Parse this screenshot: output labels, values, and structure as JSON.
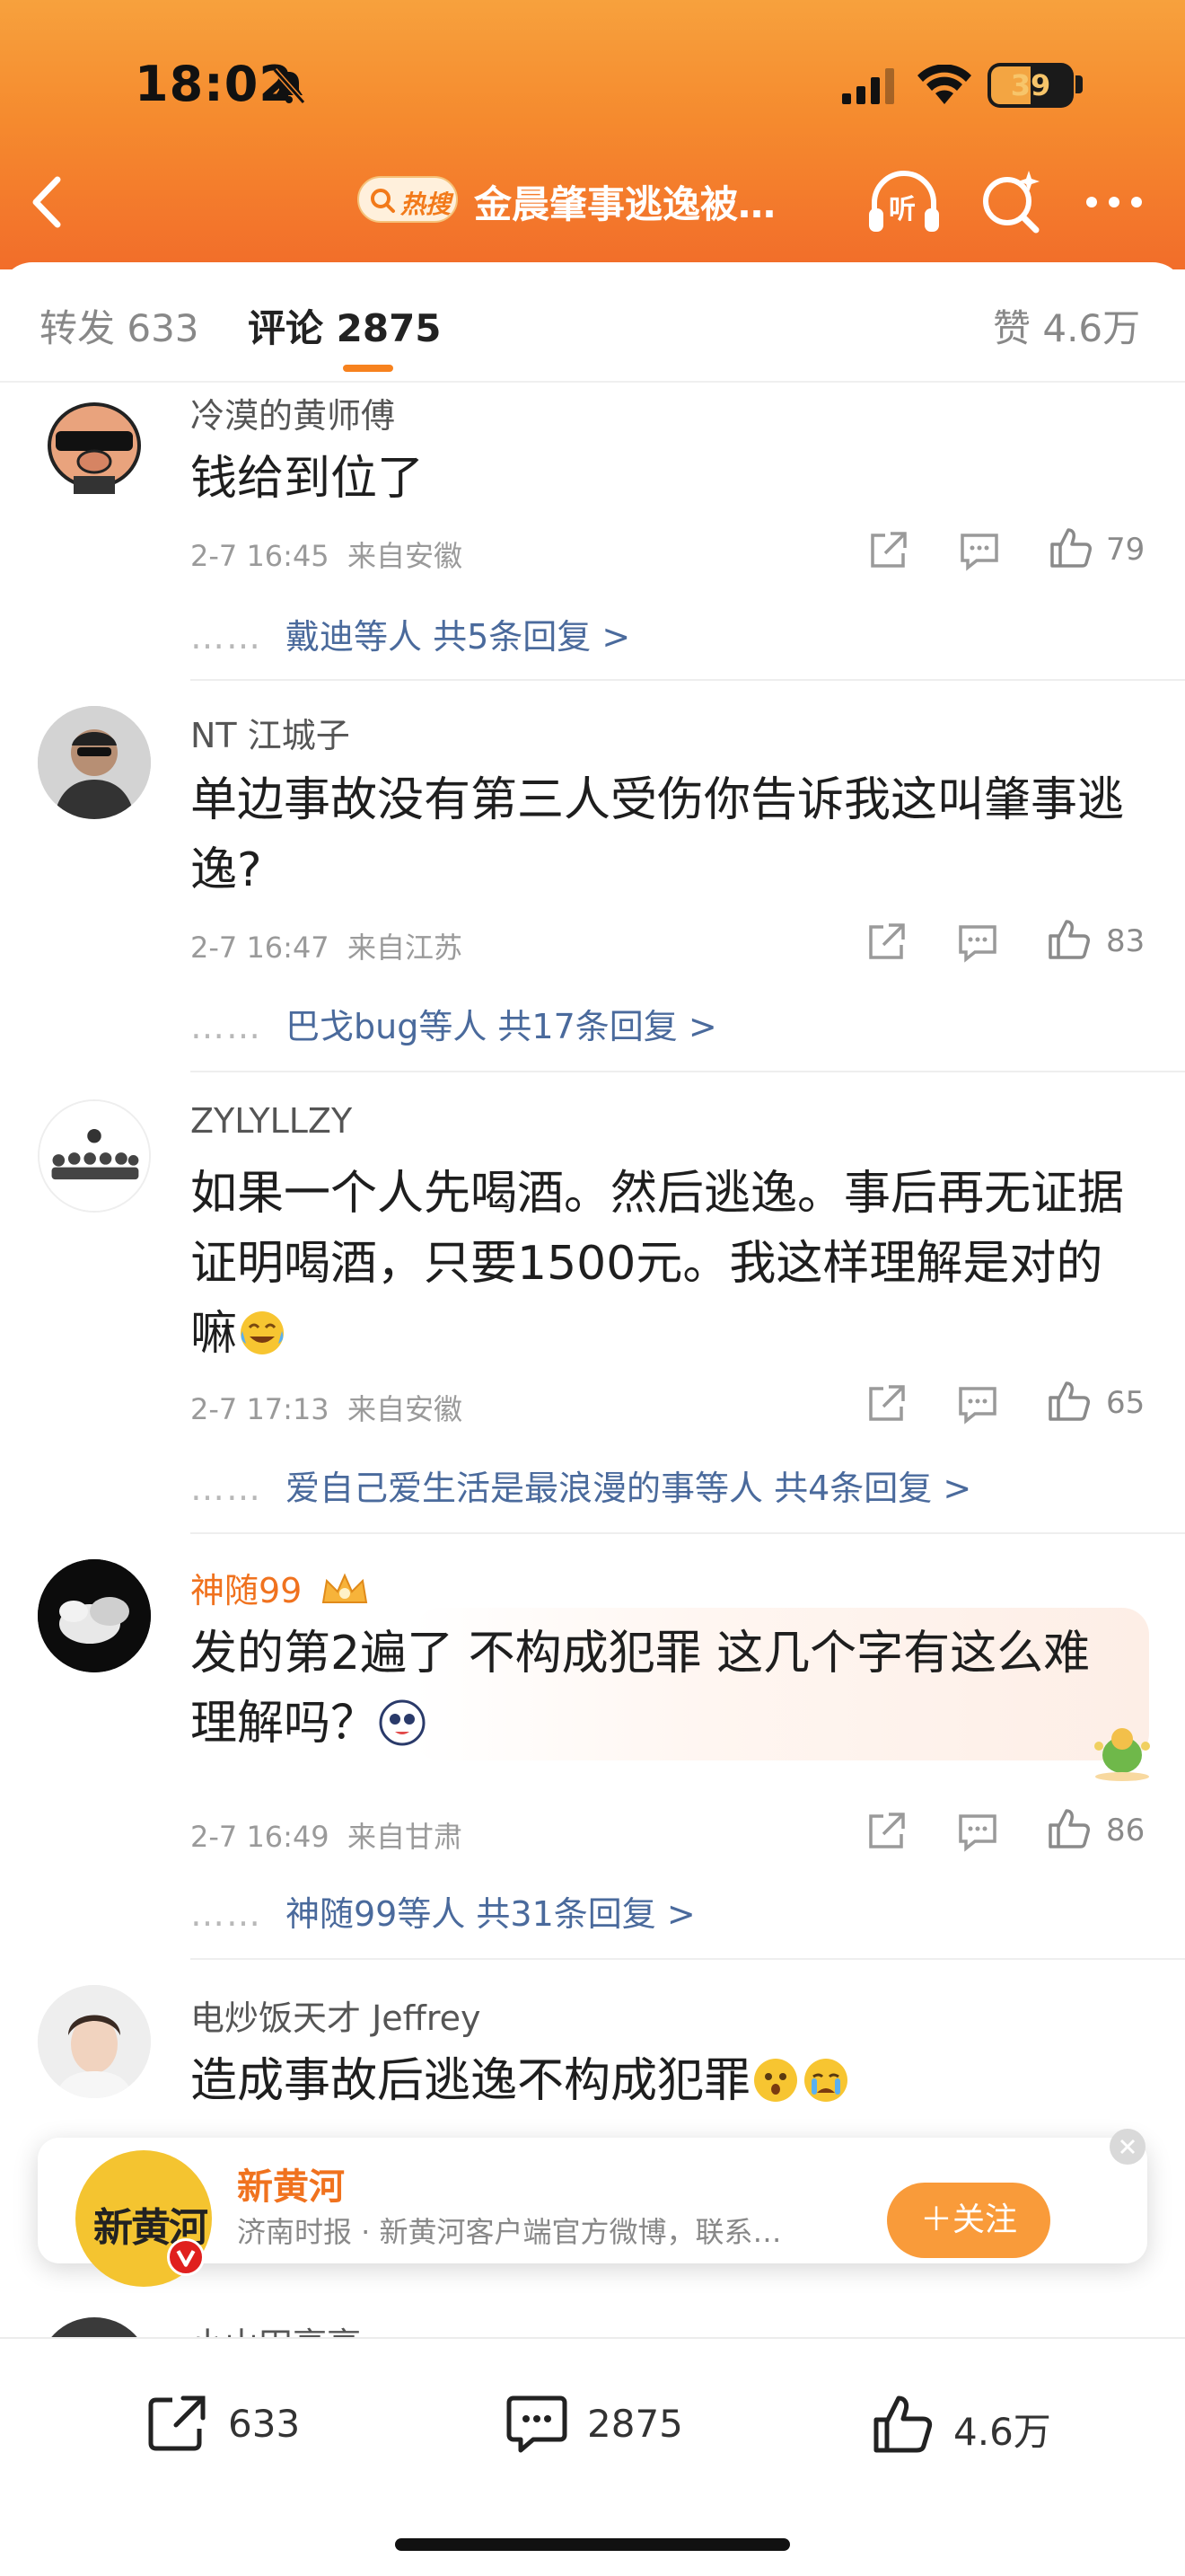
{
  "status_bar": {
    "time": "18:02",
    "battery": "39"
  },
  "header": {
    "hot_label": "热搜",
    "title": "金晨肇事逃逸被…",
    "listen_label": "听"
  },
  "tabs": {
    "reposts": "转发 633",
    "comments": "评论 2875",
    "likes": "赞 4.6万"
  },
  "comments": [
    {
      "user": "冷漠的黄师傅",
      "text": "钱给到位了",
      "time": "2-7 16:45",
      "location": "来自安徽",
      "likes": "79",
      "replies": "戴迪等人  共5条回复 >"
    },
    {
      "user": "NT 江城子",
      "text": "单边事故没有第三人受伤你告诉我这叫肇事逃逸?",
      "time": "2-7 16:47",
      "location": "来自江苏",
      "likes": "83",
      "replies": "巴戈bug等人  共17条回复 >"
    },
    {
      "user": "ZYLYLLZY",
      "text": "如果一个人先喝酒。然后逃逸。事后再无证据证明喝酒，只要1500元。我这样理解是对的嘛",
      "time": "2-7 17:13",
      "location": "来自安徽",
      "likes": "65",
      "replies": "爱自己爱生活是最浪漫的事等人  共4条回复 >"
    },
    {
      "user": "神随99",
      "text": "发的第2遍了 不构成犯罪 这几个字有这么难理解吗？",
      "time": "2-7 16:49",
      "location": "来自甘肃",
      "likes": "86",
      "replies": "神随99等人  共31条回复 >"
    },
    {
      "user": "电炒饭天才 Jeffrey",
      "text": "造成事故后逃逸不构成犯罪"
    },
    {
      "user": "小山田亭亭"
    }
  ],
  "follow_card": {
    "name": "新黄河",
    "logo_text": "新黄河",
    "description": "济南时报 · 新黄河客户端官方微博，联系…",
    "follow_label": "＋关注"
  },
  "bottom_bar": {
    "reposts": "633",
    "comments": "2875",
    "likes": "4.6万"
  },
  "colors": {
    "accent": "#f7821e",
    "header": "#f58a2e",
    "link": "#4a6a9c",
    "vip_name": "#f0721e"
  }
}
